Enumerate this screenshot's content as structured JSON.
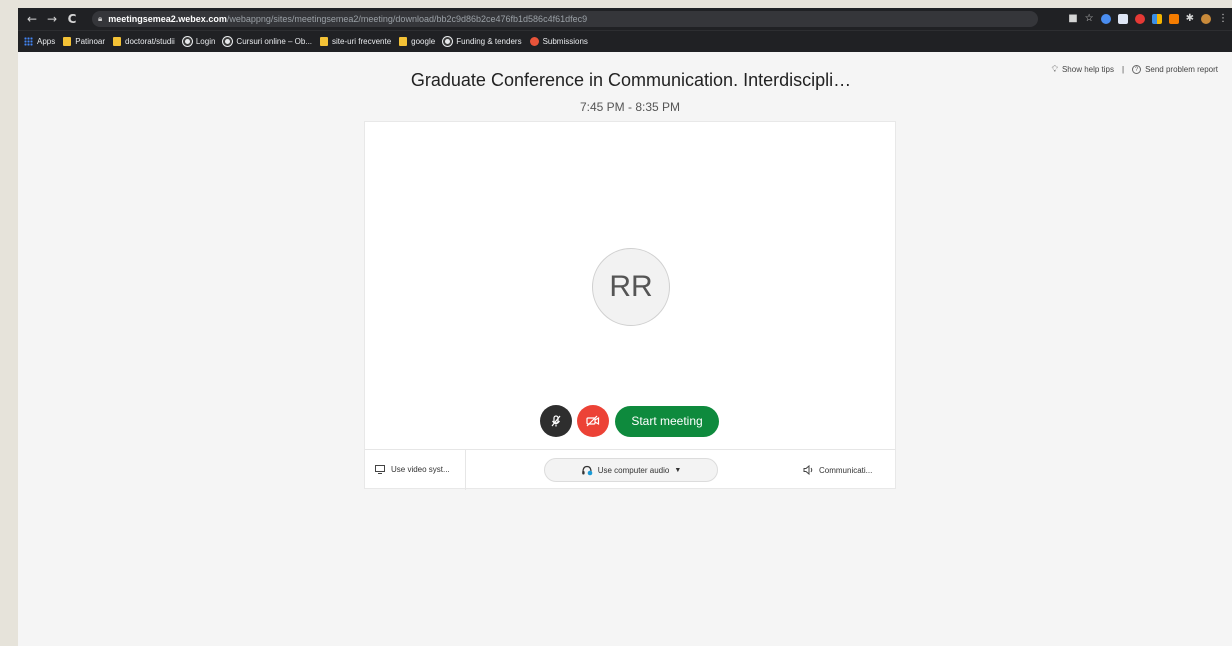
{
  "browser": {
    "nav": {
      "back": "←",
      "forward": "→",
      "reload": "C"
    },
    "url_domain": "meetingsemea2.webex.com",
    "url_path": "/webappng/sites/meetingsemea2/meeting/download/bb2c9d86b2ce476fb1d586c4f61dfec9",
    "bookmarks": [
      {
        "label": "Apps",
        "icon": "apps-grid-icon"
      },
      {
        "label": "Patinoar",
        "icon": "folder-icon"
      },
      {
        "label": "doctorat/studii",
        "icon": "folder-icon"
      },
      {
        "label": "Login",
        "icon": "globe-icon"
      },
      {
        "label": "Cursuri online – Ob...",
        "icon": "globe-icon"
      },
      {
        "label": "site-uri frecvente",
        "icon": "folder-icon"
      },
      {
        "label": "google",
        "icon": "folder-icon"
      },
      {
        "label": "Funding & tenders",
        "icon": "globe-icon"
      },
      {
        "label": "Submissions",
        "icon": "submissions-icon"
      }
    ]
  },
  "header": {
    "help_tips": "Show help tips",
    "separator": "|",
    "problem_report": "Send problem report"
  },
  "meeting": {
    "title": "Graduate Conference in Communication. Interdiscipli…",
    "time": "7:45 PM - 8:35 PM",
    "avatar_initials": "RR",
    "start_label": "Start meeting"
  },
  "footer": {
    "video_system": "Use video syst...",
    "audio": "Use computer audio",
    "communication": "Communicati..."
  },
  "colors": {
    "start_button": "#0e8a3d",
    "video_off_button": "#ec4236",
    "mute_button": "#2e2e2e"
  }
}
